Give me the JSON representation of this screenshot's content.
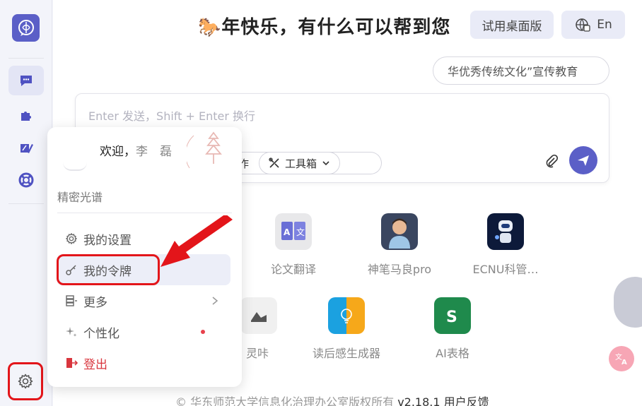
{
  "header": {
    "title": "🐎年快乐，有什么可以帮到您",
    "desktop_button": "试用桌面版",
    "lang_button": "En"
  },
  "suggestion_chip": "华优秀传统文化”宣传教育",
  "input": {
    "placeholder": "Enter 发送，Shift + Enter 换行",
    "partial_pill_text": "作",
    "toolbox_label": "工具箱"
  },
  "tools_row1": [
    {
      "label": "论文翻译",
      "icon": "translate-icon"
    },
    {
      "label": "神笔马良pro",
      "icon": "boy-avatar-icon"
    },
    {
      "label": "ECNU科管…",
      "icon": "robot-icon"
    }
  ],
  "tools_row2": [
    {
      "label": "灵咔",
      "icon": "image-icon"
    },
    {
      "label": "读后感生成器",
      "icon": "bulb-icon"
    },
    {
      "label": "AI表格",
      "icon": "sheet-icon"
    }
  ],
  "footer": {
    "copyright": "© 华东师范大学信息化治理办公室版权所有",
    "version": "v2.18.1",
    "feedback": "用户反馈"
  },
  "popup": {
    "welcome": "欢迎，",
    "welcome_name": "李　磊",
    "subtitle": "精密光谱",
    "menu": [
      {
        "label": "我的设置",
        "icon": "gear-icon"
      },
      {
        "label": "我的令牌",
        "icon": "key-icon"
      },
      {
        "label": "更多",
        "icon": "layers-icon"
      },
      {
        "label": "个性化",
        "icon": "sparkle-icon"
      },
      {
        "label": "登出",
        "icon": "logout-icon"
      }
    ]
  },
  "colors": {
    "accent": "#5b5fc7",
    "annotation_red": "#e3151a",
    "logout_red": "#d9363e"
  }
}
